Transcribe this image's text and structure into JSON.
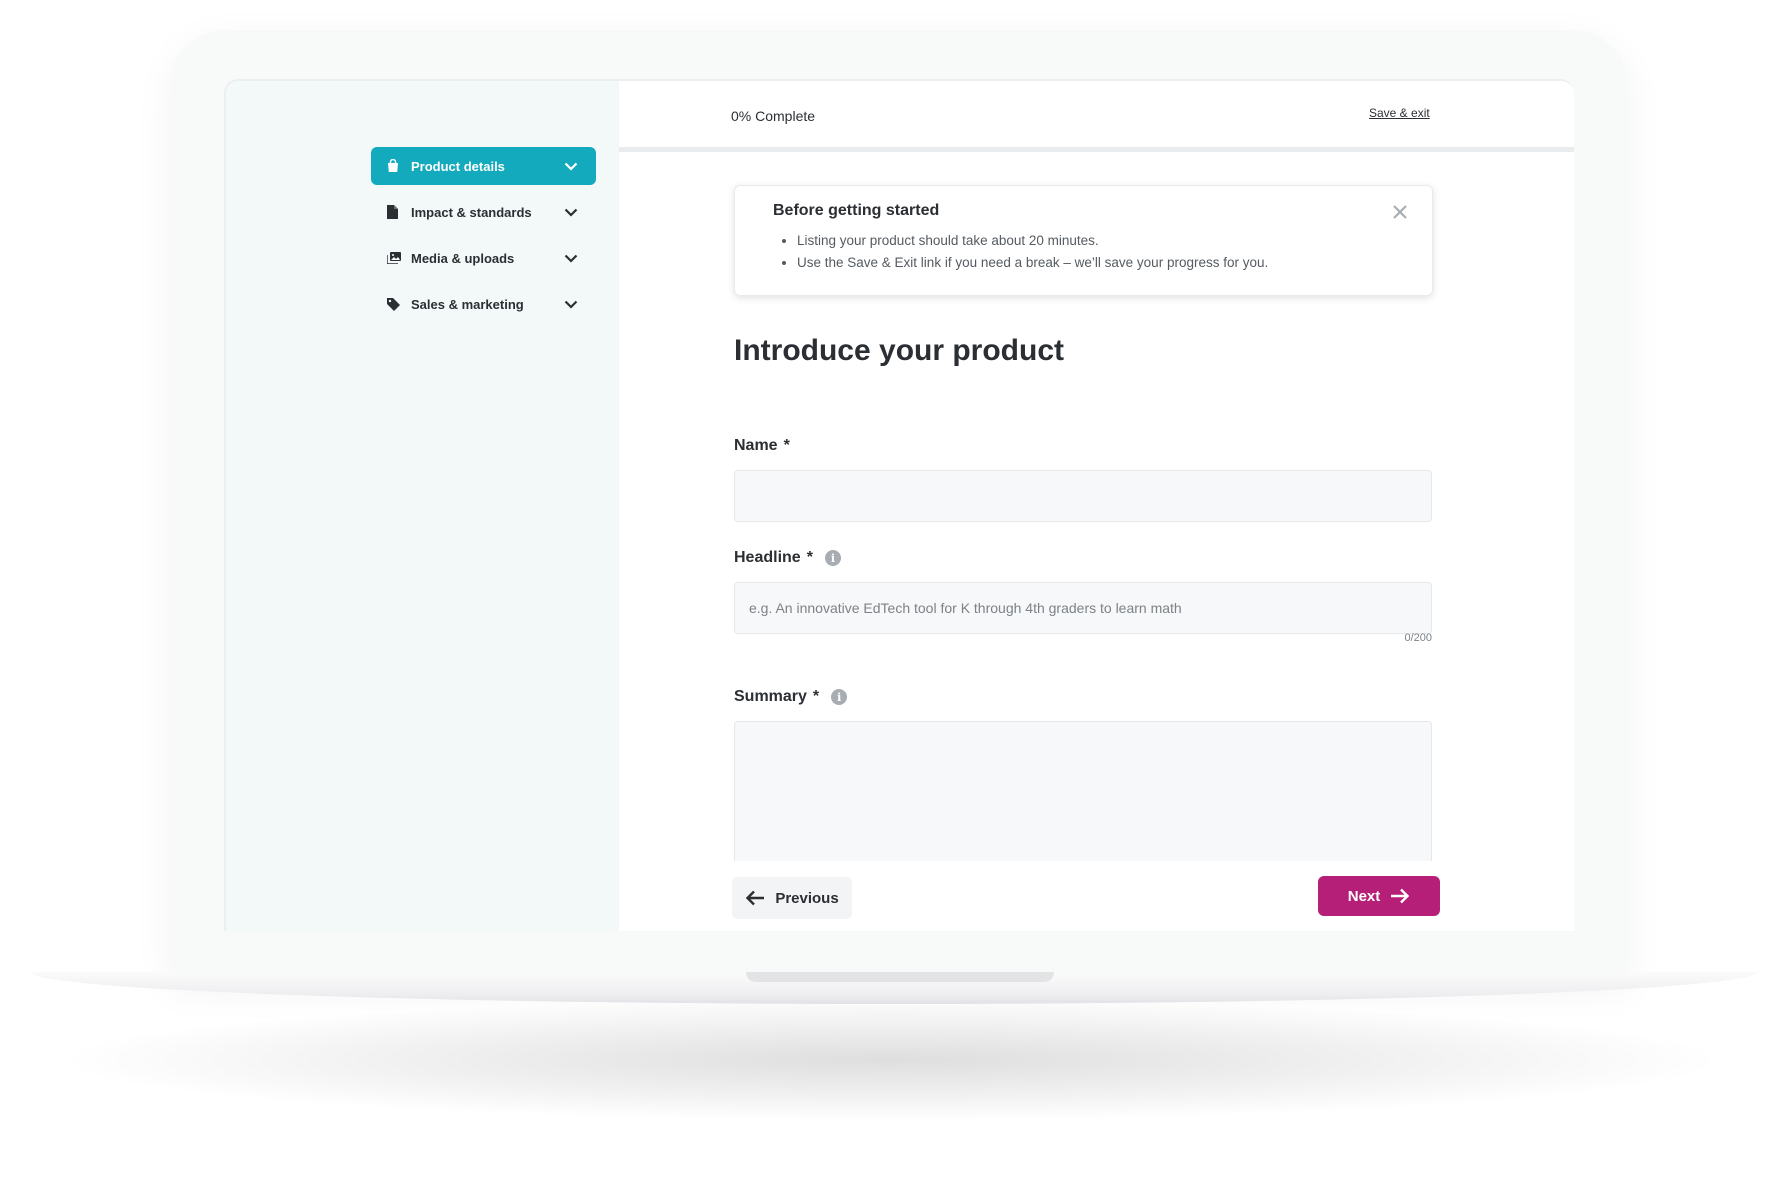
{
  "progress": {
    "label": "0% Complete",
    "value": 0
  },
  "header": {
    "save_exit": "Save & exit"
  },
  "sidebar": {
    "items": [
      {
        "label": "Product details",
        "icon": "shopping-bag-icon",
        "active": true
      },
      {
        "label": "Impact & standards",
        "icon": "document-icon",
        "active": false
      },
      {
        "label": "Media & uploads",
        "icon": "images-icon",
        "active": false
      },
      {
        "label": "Sales & marketing",
        "icon": "tag-icon",
        "active": false
      }
    ]
  },
  "notice": {
    "title": "Before getting started",
    "bullets": [
      "Listing your product should take about 20 minutes.",
      "Use the Save & Exit link if you need a break – we’ll save your progress for you."
    ]
  },
  "page": {
    "title": "Introduce your product"
  },
  "form": {
    "name": {
      "label": "Name",
      "required": "*",
      "value": "",
      "placeholder": ""
    },
    "headline": {
      "label": "Headline",
      "required": "*",
      "value": "",
      "placeholder": "e.g. An innovative EdTech tool for K through 4th graders to learn math",
      "counter": "0/200"
    },
    "summary": {
      "label": "Summary",
      "required": "*",
      "value": "",
      "placeholder": ""
    }
  },
  "buttons": {
    "previous": "Previous",
    "next": "Next"
  },
  "colors": {
    "accent": "#14aabd",
    "primary_button": "#b51f78",
    "sidebar_bg": "#f3f8f9"
  }
}
